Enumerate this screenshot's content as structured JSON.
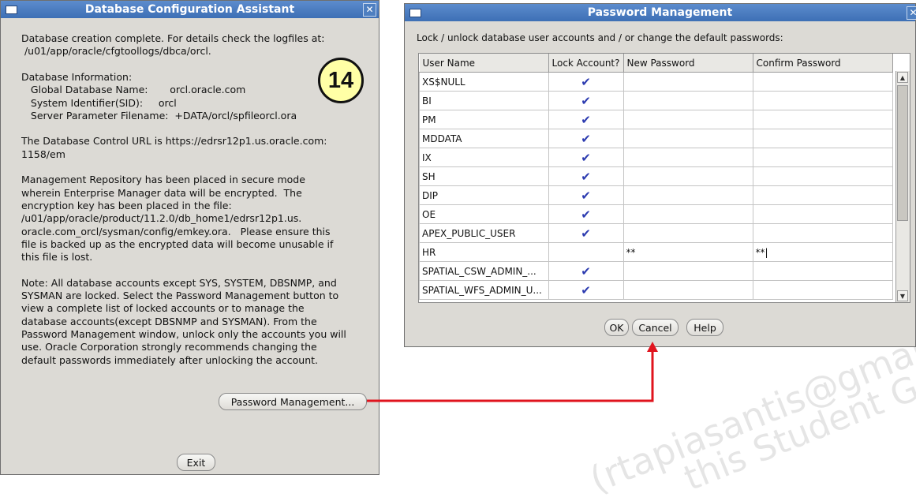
{
  "dbca": {
    "title": "Database Configuration Assistant",
    "lines": [
      "Database creation complete. For details check the logfiles at:",
      " /u01/app/oracle/cfgtoollogs/dbca/orcl.",
      "",
      "Database Information:",
      "   Global Database Name:       orcl.oracle.com",
      "   System Identifier(SID):     orcl",
      "   Server Parameter Filename:  +DATA/orcl/spfileorcl.ora",
      "",
      "The Database Control URL is https://edrsr12p1.us.oracle.com:",
      "1158/em",
      "",
      "Management Repository has been placed in secure mode",
      "wherein Enterprise Manager data will be encrypted.  The",
      "encryption key has been placed in the file:",
      "/u01/app/oracle/product/11.2.0/db_home1/edrsr12p1.us.",
      "oracle.com_orcl/sysman/config/emkey.ora.   Please ensure this",
      "file is backed up as the encrypted data will become unusable if",
      "this file is lost.",
      "",
      "Note: All database accounts except SYS, SYSTEM, DBSNMP, and",
      "SYSMAN are locked. Select the Password Management button to",
      "view a complete list of locked accounts or to manage the",
      "database accounts(except DBSNMP and SYSMAN). From the",
      "Password Management window, unlock only the accounts you will",
      "use. Oracle Corporation strongly recommends changing the",
      "default passwords immediately after unlocking the account."
    ],
    "password_button": "Password Management...",
    "exit_button": "Exit",
    "step_badge": "14"
  },
  "pwd": {
    "title": "Password Management",
    "instruction": "Lock / unlock database user accounts and / or change the default passwords:",
    "columns": [
      "User Name",
      "Lock Account?",
      "New Password",
      "Confirm Password"
    ],
    "rows": [
      {
        "user": "XS$NULL",
        "lock": "✔",
        "new": "",
        "confirm": ""
      },
      {
        "user": "BI",
        "lock": "✔",
        "new": "",
        "confirm": ""
      },
      {
        "user": "PM",
        "lock": "✔",
        "new": "",
        "confirm": ""
      },
      {
        "user": "MDDATA",
        "lock": "✔",
        "new": "",
        "confirm": ""
      },
      {
        "user": "IX",
        "lock": "✔",
        "new": "",
        "confirm": ""
      },
      {
        "user": "SH",
        "lock": "✔",
        "new": "",
        "confirm": ""
      },
      {
        "user": "DIP",
        "lock": "✔",
        "new": "",
        "confirm": ""
      },
      {
        "user": "OE",
        "lock": "✔",
        "new": "",
        "confirm": ""
      },
      {
        "user": "APEX_PUBLIC_USER",
        "lock": "✔",
        "new": "",
        "confirm": ""
      },
      {
        "user": "HR",
        "lock": "",
        "new": "**",
        "confirm": "**|"
      },
      {
        "user": "SPATIAL_CSW_ADMIN_...",
        "lock": "✔",
        "new": "",
        "confirm": ""
      },
      {
        "user": "SPATIAL_WFS_ADMIN_U...",
        "lock": "✔",
        "new": "",
        "confirm": ""
      }
    ],
    "ok_button": "OK",
    "cancel_button": "Cancel",
    "help_button": "Help"
  },
  "watermark": {
    "line1": "(rtapiasantis@gmail.com) has",
    "line2": "this Student Guide."
  },
  "colors": {
    "arrow": "#e0141e",
    "titlebar": "#3d6fb5",
    "check": "#2c3bb0",
    "badge": "#ffffa6"
  }
}
